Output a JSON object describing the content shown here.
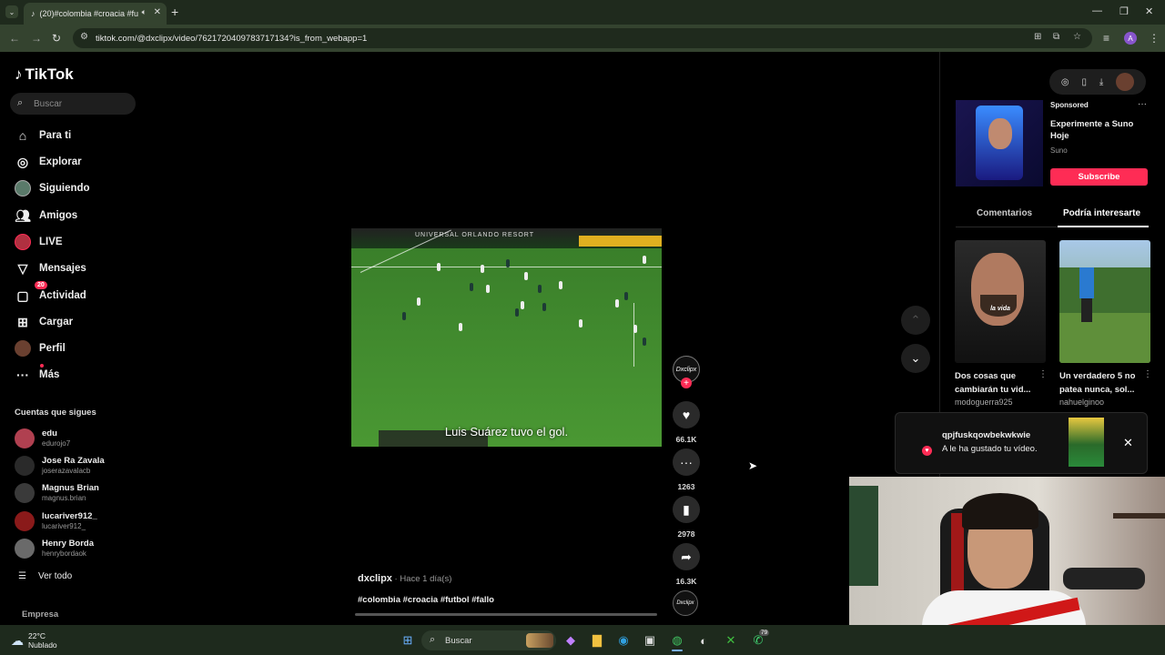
{
  "browser": {
    "tab_title": "(20)#colombia #croacia #fu",
    "url": "tiktok.com/@dxclipx/video/7621720409783717134?is_from_webapp=1",
    "profile_initial": "A"
  },
  "tiktok": {
    "logo": "TikTok",
    "search_placeholder": "Buscar",
    "nav": [
      {
        "label": "Para ti",
        "icon": "home-icon"
      },
      {
        "label": "Explorar",
        "icon": "compass-icon"
      },
      {
        "label": "Siguiendo",
        "icon": "avatar-icon"
      },
      {
        "label": "Amigos",
        "icon": "friends-icon"
      },
      {
        "label": "LIVE",
        "icon": "live-icon"
      },
      {
        "label": "Mensajes",
        "icon": "send-icon"
      },
      {
        "label": "Actividad",
        "icon": "activity-icon",
        "badge": "20"
      },
      {
        "label": "Cargar",
        "icon": "upload-icon"
      },
      {
        "label": "Perfil",
        "icon": "profile-icon"
      },
      {
        "label": "Más",
        "icon": "more-icon"
      }
    ],
    "following_title": "Cuentas que sigues",
    "following": [
      {
        "name": "edu",
        "user": "edurojo7"
      },
      {
        "name": "Jose Ra Zavala",
        "user": "joserazavalacb"
      },
      {
        "name": "Magnus Brian",
        "user": "magnus.brian"
      },
      {
        "name": "lucariver912_",
        "user": "lucariver912_"
      },
      {
        "name": "Henry Borda",
        "user": "henrybordaok"
      }
    ],
    "see_all": "Ver todo",
    "company": "Empresa"
  },
  "video": {
    "caption": "Luis Suárez tuvo el gol.",
    "stadium_ad": "UNIVERSAL ORLANDO RESORT",
    "author": "dxclipx",
    "time": " · Hace 1 día(s)",
    "tags": "#colombia #croacia #futbol #fallo",
    "avatar_text": "Dxclipx",
    "likes": "66.1K",
    "comments": "1263",
    "saves": "2978",
    "shares": "16.3K"
  },
  "right": {
    "sponsored": "Sponsored",
    "ad_title": "Experimente a Suno Hoje",
    "ad_brand": "Suno",
    "subscribe": "Subscribe",
    "tab_comments": "Comentarios",
    "tab_interest": "Podría interesarte",
    "videos": [
      {
        "title": "Dos cosas que cambiarán tu vid...",
        "author": "modoguerra925",
        "overlay": "la vida"
      },
      {
        "title": "Un verdadero 5 no patea nunca, sol...",
        "author": "nahuelginoo"
      }
    ]
  },
  "toast": {
    "name": "qpjfuskqowbekwkwie",
    "message": "A le ha gustado tu vídeo."
  },
  "taskbar": {
    "temp": "22°C",
    "condition": "Nublado",
    "search": "Buscar",
    "whatsapp_badge": "79"
  }
}
